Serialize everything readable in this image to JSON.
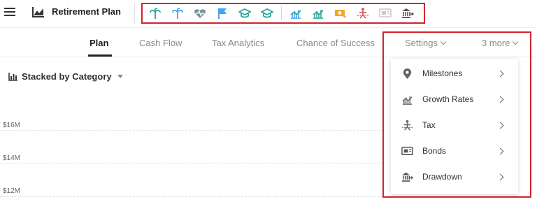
{
  "app": {
    "title": "Retirement Plan"
  },
  "toolbar": {
    "icons": [
      "palm-tree-icon",
      "palm-tree-icon",
      "heart-pulse-icon",
      "flag-icon",
      "graduation-cap-icon",
      "graduation-cap-icon",
      "growth-chart-icon",
      "growth-chart-icon",
      "money-cash-icon",
      "tax-icon",
      "bonds-certificate-icon",
      "bank-drawdown-icon"
    ],
    "colors": {
      "teal": "#26a69a",
      "blue": "#42a5f5",
      "gray": "#78909c",
      "orange": "#f5a623",
      "red": "#e35d5d",
      "light_gray": "#c8c8c8",
      "dark": "#555555"
    }
  },
  "tabs": [
    {
      "label": "Plan",
      "active": true
    },
    {
      "label": "Cash Flow",
      "active": false
    },
    {
      "label": "Tax Analytics",
      "active": false
    },
    {
      "label": "Chance of Success",
      "active": false
    },
    {
      "label": "Settings",
      "active": false
    },
    {
      "label": "3 more",
      "active": false
    }
  ],
  "chart": {
    "view_label": "Stacked by Category",
    "y_ticks": [
      "$16M",
      "$14M",
      "$12M"
    ]
  },
  "dropdown": {
    "items": [
      {
        "label": "Milestones",
        "icon": "map-pin-icon"
      },
      {
        "label": "Growth Rates",
        "icon": "growth-chart-icon"
      },
      {
        "label": "Tax",
        "icon": "tax-icon"
      },
      {
        "label": "Bonds",
        "icon": "bonds-certificate-icon"
      },
      {
        "label": "Drawdown",
        "icon": "bank-drawdown-icon"
      }
    ]
  },
  "highlight_color": "#d2232a"
}
